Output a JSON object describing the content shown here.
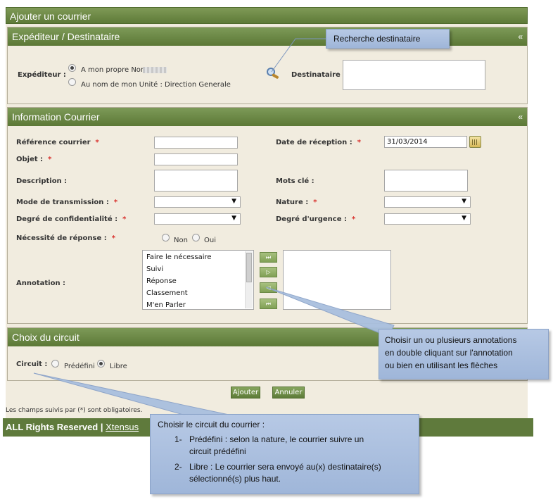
{
  "header": {
    "title": "Ajouter un courrier"
  },
  "sender_section": {
    "title": "Expéditeur / Destinataire",
    "collapse": "«",
    "sender_label": "Expéditeur :",
    "option_own_name": "A mon propre Nom :",
    "option_unit_name": "Au nom de mon Unité : Direction Generale",
    "recipient_label": "Destinataire :"
  },
  "info_section": {
    "title": "Information Courrier",
    "collapse": "«",
    "required_mark": "*",
    "reference_label": "Référence courrier",
    "object_label": "Objet :",
    "description_label": "Description :",
    "transmission_label": "Mode de transmission :",
    "confidentiality_label": "Degré de confidentialité :",
    "response_label": "Nécessité de réponse :",
    "response_no": "Non",
    "response_yes": "Oui",
    "annotation_label": "Annotation :",
    "reception_label": "Date de réception :",
    "reception_value": "31/03/2014",
    "keywords_label": "Mots clé :",
    "nature_label": "Nature :",
    "urgency_label": "Degré d'urgence :",
    "select_arrow": "▼",
    "annotations": [
      "Faire le nécessaire",
      "Suivi",
      "Réponse",
      "Classement",
      "M'en Parler"
    ],
    "move_buttons": [
      "⏭",
      "▷",
      "◁",
      "⏮"
    ]
  },
  "circuit_section": {
    "title": "Choix du circuit",
    "circuit_label": "Circuit :",
    "option_predefined": "Prédéfini",
    "option_free": "Libre"
  },
  "actions": {
    "add_label": "Ajouter",
    "cancel_label": "Annuler"
  },
  "required_note": "Les champs suivis par (*) sont obligatoires.",
  "footer": {
    "rights": "ALL Rights Reserved |",
    "link": "Xtensus"
  },
  "callouts": {
    "recipient_search": "Recherche destinataire",
    "annotations_help": [
      "Choisir un ou plusieurs annotations",
      "en double cliquant sur l'annotation",
      "ou bien en utilisant les flèches"
    ],
    "circuit_title": "Choisir le circuit du courrier :",
    "circuit_item1_num": "1-",
    "circuit_item1": [
      "Prédéfini : selon la nature, le courrier suivre un",
      "circuit prédéfini"
    ],
    "circuit_item2_num": "2-",
    "circuit_item2": [
      "Libre : Le courrier sera envoyé au(x) destinataire(s)",
      "sélectionné(s) plus haut."
    ]
  },
  "colors": {
    "header_green": "#5e7a38",
    "background": "#f1ecdf",
    "callout_blue": "#a9bfde",
    "required_red": "#d9302c"
  },
  "icons": {
    "search": "search-icon",
    "calendar": "calendar-icon"
  }
}
